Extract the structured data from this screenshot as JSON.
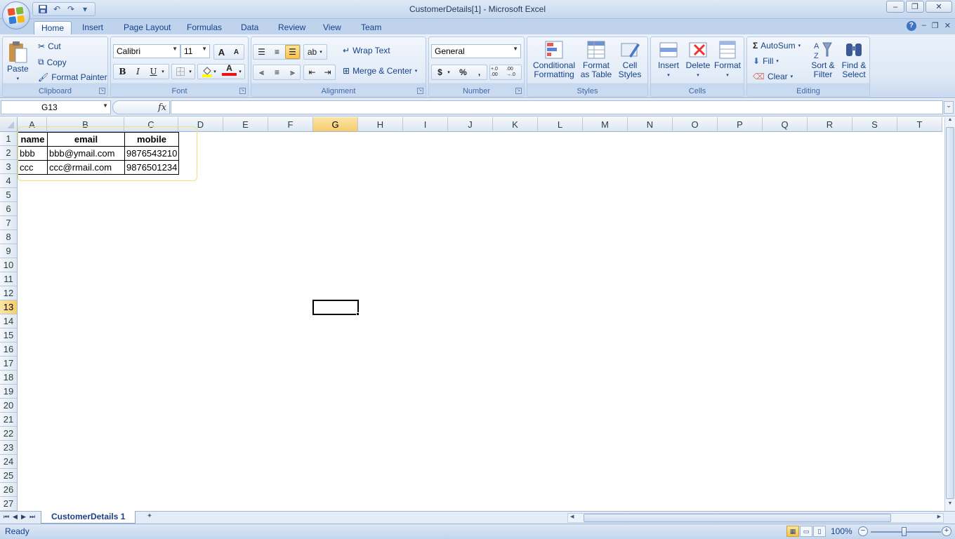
{
  "window": {
    "title": "CustomerDetails[1] - Microsoft Excel",
    "controls": {
      "minimize": "–",
      "restore": "❐",
      "close": "✕"
    }
  },
  "quick_access": {
    "save_icon": "save-icon",
    "undo_icon": "undo-icon",
    "redo_icon": "redo-icon",
    "customize": "▾"
  },
  "ribbon_tabs": [
    "Home",
    "Insert",
    "Page Layout",
    "Formulas",
    "Data",
    "Review",
    "View",
    "Team"
  ],
  "ribbon_tab_active": "Home",
  "ribbon": {
    "clipboard": {
      "label": "Clipboard",
      "paste": "Paste",
      "cut": "Cut",
      "copy": "Copy",
      "format_painter": "Format Painter"
    },
    "font": {
      "label": "Font",
      "font_name": "Calibri",
      "font_size": "11",
      "bold": "B",
      "italic": "I",
      "underline": "U",
      "grow": "A",
      "shrink": "A",
      "font_color": "A"
    },
    "alignment": {
      "label": "Alignment",
      "wrap_text": "Wrap Text",
      "merge_center": "Merge & Center"
    },
    "number": {
      "label": "Number",
      "format": "General",
      "currency": "$",
      "percent": "%",
      "comma": ",",
      "inc_decimal": "+.0 .00",
      "dec_decimal": ".00 →.0"
    },
    "styles": {
      "label": "Styles",
      "conditional_formatting": "Conditional Formatting",
      "format_as_table": "Format as Table",
      "cell_styles": "Cell Styles"
    },
    "cells": {
      "label": "Cells",
      "insert": "Insert",
      "delete": "Delete",
      "format": "Format"
    },
    "editing": {
      "label": "Editing",
      "autosum": "AutoSum",
      "fill": "Fill",
      "clear": "Clear",
      "sort_filter": "Sort & Filter",
      "find_select": "Find & Select"
    }
  },
  "formula_bar": {
    "name_box": "G13",
    "fx": "fx",
    "formula": ""
  },
  "grid": {
    "columns": [
      "A",
      "B",
      "C",
      "D",
      "E",
      "F",
      "G",
      "H",
      "I",
      "J",
      "K",
      "L",
      "M",
      "N",
      "O",
      "P",
      "Q",
      "R",
      "S",
      "T"
    ],
    "rows": [
      "1",
      "2",
      "3",
      "4",
      "5",
      "6",
      "7",
      "8",
      "9",
      "10",
      "11",
      "12",
      "13",
      "14",
      "15",
      "16",
      "17",
      "18",
      "19",
      "20",
      "21",
      "22",
      "23",
      "24",
      "25",
      "26",
      "27"
    ],
    "selected_cell": "G13",
    "data": {
      "headers": [
        "name",
        "email",
        "mobile"
      ],
      "rows": [
        [
          "bbb",
          "bbb@ymail.com",
          "9876543210"
        ],
        [
          "ccc",
          "ccc@rmail.com",
          "9876501234"
        ]
      ]
    }
  },
  "sheets": {
    "active": "CustomerDetails 1",
    "nav": [
      "⏮",
      "◀",
      "▶",
      "⏭"
    ]
  },
  "status": {
    "text": "Ready",
    "zoom": "100%",
    "zoom_out": "−",
    "zoom_in": "+"
  }
}
